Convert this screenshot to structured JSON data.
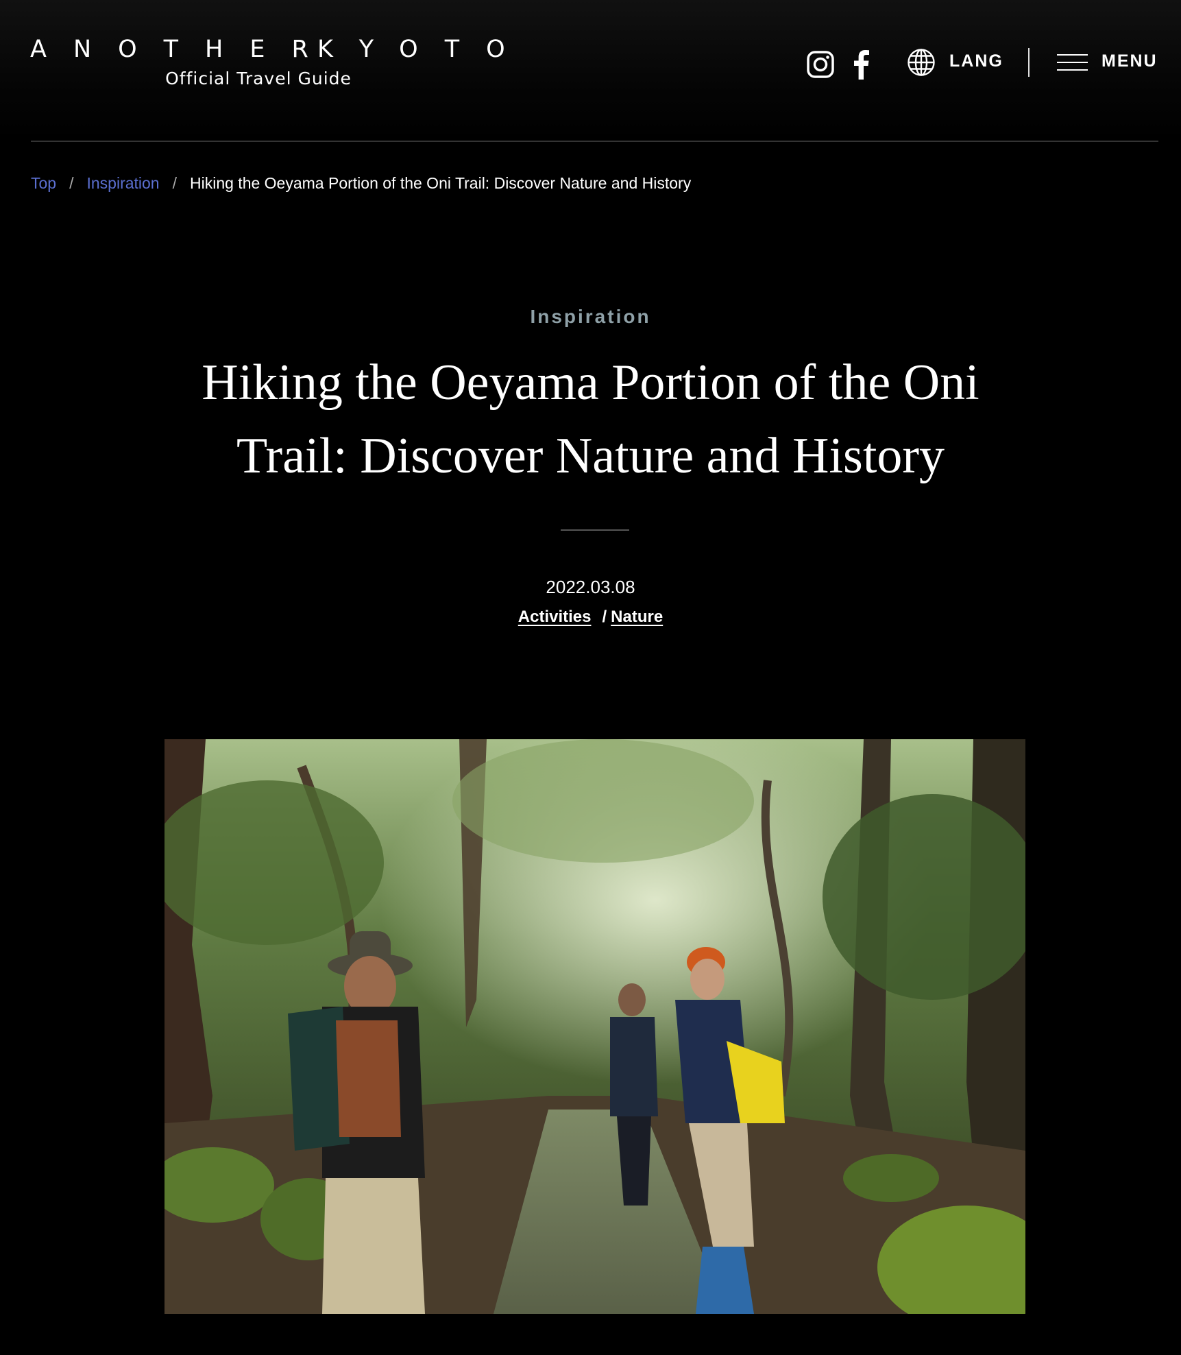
{
  "header": {
    "logo_word_1": "ANOTHER",
    "logo_word_2": "KYOTO",
    "logo_subtitle": "Official Travel Guide",
    "lang_label": "LANG",
    "menu_label": "MENU"
  },
  "breadcrumb": {
    "items": [
      "Top",
      "Inspiration"
    ],
    "separator": "/",
    "current": "Hiking the Oeyama Portion of the Oni Trail: Discover Nature and History"
  },
  "article": {
    "category": "Inspiration",
    "title": "Hiking the Oeyama Portion of the Oni Trail: Discover Nature and History",
    "date": "2022.03.08",
    "tags": [
      "Activities",
      "Nature"
    ],
    "tag_separator": "/"
  },
  "colors": {
    "background": "#000000",
    "link": "#5b6fd0",
    "category": "#8fa1a8"
  },
  "icons": [
    "instagram-icon",
    "facebook-icon",
    "globe-icon",
    "hamburger-menu-icon"
  ]
}
